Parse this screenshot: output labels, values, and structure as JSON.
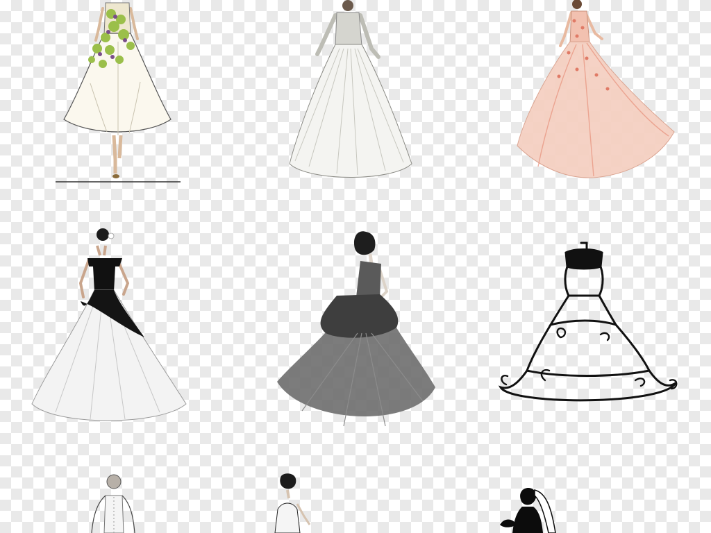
{
  "canvas": {
    "background": "transparency-checkerboard",
    "checker_colors": [
      "#ffffff",
      "#e9e9e9"
    ]
  },
  "gallery": {
    "rows": 3,
    "columns": 3,
    "items": [
      {
        "id": "floral-ivory-tea-gown",
        "palette": [
          "#fbf8ee",
          "#9bbf4a",
          "#7a4e8a"
        ]
      },
      {
        "id": "lace-sleeve-ballgown",
        "palette": [
          "#f4f4f1",
          "#b8b8b0"
        ]
      },
      {
        "id": "blush-tulle-gown",
        "palette": [
          "#f2c1b0",
          "#e7907a"
        ]
      },
      {
        "id": "black-white-offshoulder-gown",
        "palette": [
          "#111111",
          "#f3f3f3"
        ]
      },
      {
        "id": "grey-feather-ballgown",
        "palette": [
          "#6e6e6e",
          "#3e3e3e"
        ]
      },
      {
        "id": "line-art-dress-form",
        "palette": [
          "#111111"
        ]
      },
      {
        "id": "back-view-bride-sketch",
        "palette": [
          "#f5f5f5",
          "#444444"
        ]
      },
      {
        "id": "short-hair-bride-sketch",
        "palette": [
          "#f5f5f5",
          "#222222"
        ]
      },
      {
        "id": "bride-veil-silhouette",
        "palette": [
          "#0c0c0c"
        ]
      }
    ]
  }
}
